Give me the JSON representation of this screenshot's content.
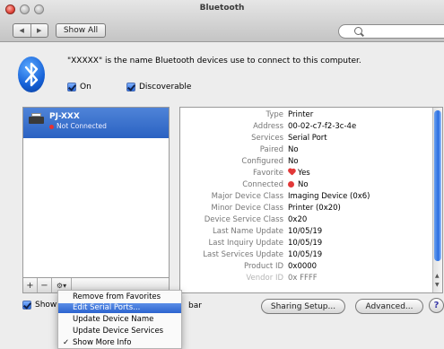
{
  "window": {
    "title": "Bluetooth",
    "show_all": "Show All",
    "nav_back": "◀",
    "nav_forward": "▶"
  },
  "intro": {
    "text": "\"XXXXX\" is the name Bluetooth devices use to connect to this computer.",
    "on_label": "On",
    "discoverable_label": "Discoverable"
  },
  "devices": [
    {
      "name": "PJ-XXX",
      "status": "Not Connected"
    }
  ],
  "list_bar": {
    "add": "+",
    "remove": "−",
    "gear": "⚙▾"
  },
  "info_rows": [
    {
      "key": "Type",
      "value": "Printer"
    },
    {
      "key": "Address",
      "value": "00-02-c7-f2-3c-4e"
    },
    {
      "key": "Services",
      "value": "Serial Port"
    },
    {
      "key": "Paired",
      "value": "No"
    },
    {
      "key": "Configured",
      "value": "No"
    },
    {
      "key": "Favorite",
      "value": "Yes"
    },
    {
      "key": "Connected",
      "value": "No"
    },
    {
      "key": "Major Device Class",
      "value": "Imaging Device (0x6)"
    },
    {
      "key": "Minor Device Class",
      "value": "Printer (0x20)"
    },
    {
      "key": "Device Service Class",
      "value": "0x20"
    },
    {
      "key": "Last Name Update",
      "value": "10/05/19"
    },
    {
      "key": "Last Inquiry Update",
      "value": "10/05/19"
    },
    {
      "key": "Last Services Update",
      "value": "10/05/19"
    },
    {
      "key": "Product ID",
      "value": "0x0000"
    },
    {
      "key": "Vendor ID",
      "value": "0x FFFF"
    }
  ],
  "bottom": {
    "show_label": "Show",
    "menubar_label": "bar",
    "sharing_setup": "Sharing Setup...",
    "advanced": "Advanced...",
    "help": "?"
  },
  "gear_menu": [
    {
      "label": "Remove from Favorites",
      "selected": false,
      "checked": false
    },
    {
      "label": "Edit Serial Ports...",
      "selected": true,
      "checked": false
    },
    {
      "label": "Update Device Name",
      "selected": false,
      "checked": false
    },
    {
      "label": "Update Device Services",
      "selected": false,
      "checked": false
    },
    {
      "label": "Show More Info",
      "selected": false,
      "checked": true
    }
  ],
  "icons": {
    "check": "✓",
    "search": "search-icon",
    "bluetooth": "bluetooth-icon"
  }
}
